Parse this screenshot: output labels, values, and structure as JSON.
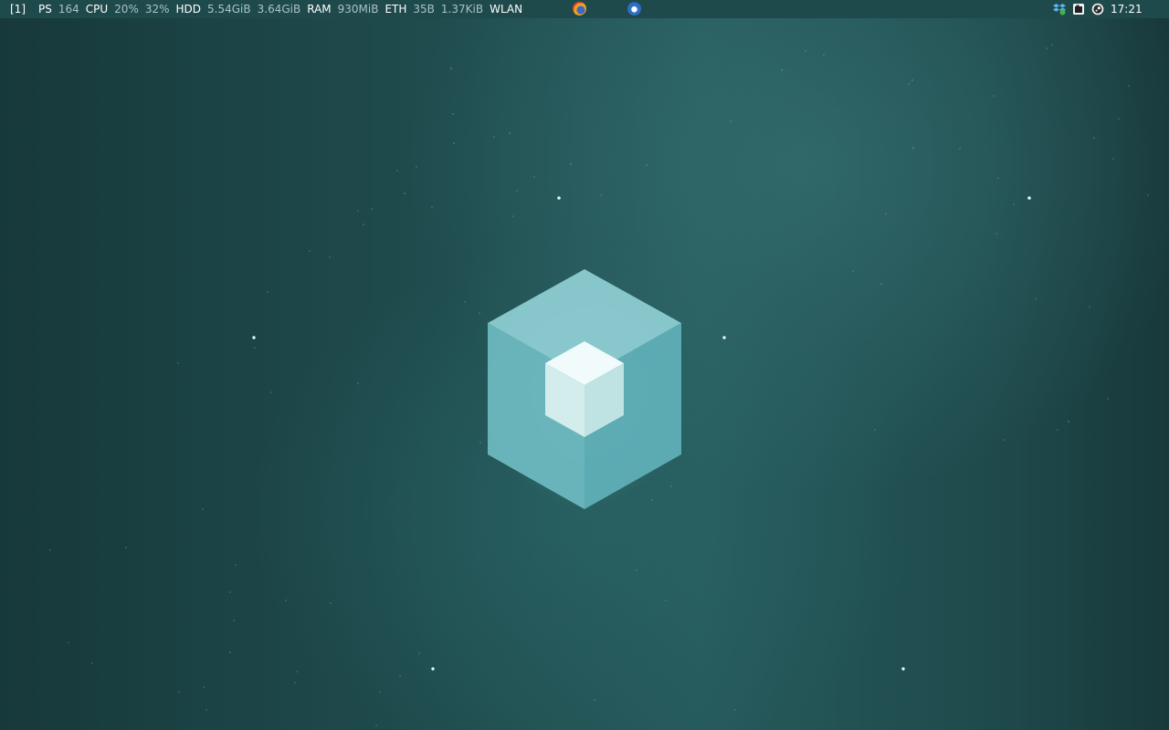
{
  "top_bar": {
    "workspace": "[1]",
    "ps_label": "PS",
    "ps_value": "164",
    "cpu_label": "CPU",
    "cpu_value_1": "20%",
    "cpu_value_2": "32%",
    "hdd_label": "HDD",
    "hdd_value_1": "5.54GiB",
    "hdd_value_2": "3.64GiB",
    "ram_label": "RAM",
    "ram_value": "930MiB",
    "eth_label": "ETH",
    "eth_value_1": "35B",
    "eth_value_2": "1.37KiB",
    "wlan_label": "WLAN",
    "clock": "17:21"
  },
  "launchers": [
    {
      "icon": "firefox-icon"
    },
    {
      "icon": "thunderbird-icon"
    }
  ],
  "tray": [
    {
      "icon": "dropbox-icon"
    },
    {
      "icon": "screenshot-icon"
    },
    {
      "icon": "steam-icon"
    }
  ],
  "colors": {
    "bar_background": "#1f4a4c",
    "desktop_base": "#1f4b4d",
    "cube_outer": "#6cb7bd",
    "cube_inner": "#d9eeee"
  }
}
